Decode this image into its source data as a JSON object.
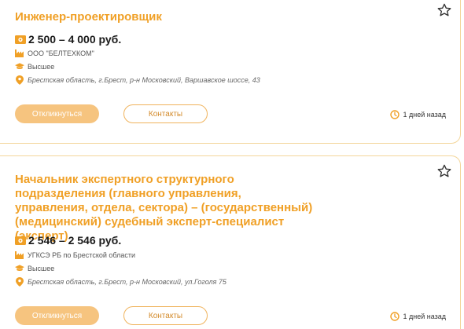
{
  "colors": {
    "accent": "#f0a026",
    "button_fill": "#f6c47f",
    "border": "#f3d69a"
  },
  "icons": {
    "salary": "money-icon",
    "company": "factory-icon",
    "education": "graduation-cap-icon",
    "location": "location-pin-icon",
    "time": "clock-icon",
    "favorite": "star-outline-icon"
  },
  "vacancies": [
    {
      "title": "Инженер-проектировщик",
      "salary": "2 500 – 4 000 руб.",
      "company": "ООО \"БЕЛТЕХКОМ\"",
      "education": "Высшее",
      "address": "Брестская область, г.Брест, р-н Московский, Варшавское шоссе, 43",
      "apply_label": "Откликнуться",
      "contacts_label": "Контакты",
      "posted": "1 дней назад"
    },
    {
      "title": "Начальник экспертного структурного подразделения (главного управления, управления, отдела, сектора) – (государственный) (медицинский) судебный эксперт-специалист (эксперт)",
      "salary": "2 546 – 2 546 руб.",
      "company": "УГКСЭ РБ по Брестской области",
      "education": "Высшее",
      "address": "Брестская область, г.Брест, р-н Московский, ул.Гоголя 75",
      "apply_label": "Откликнуться",
      "contacts_label": "Контакты",
      "posted": "1 дней назад"
    }
  ]
}
